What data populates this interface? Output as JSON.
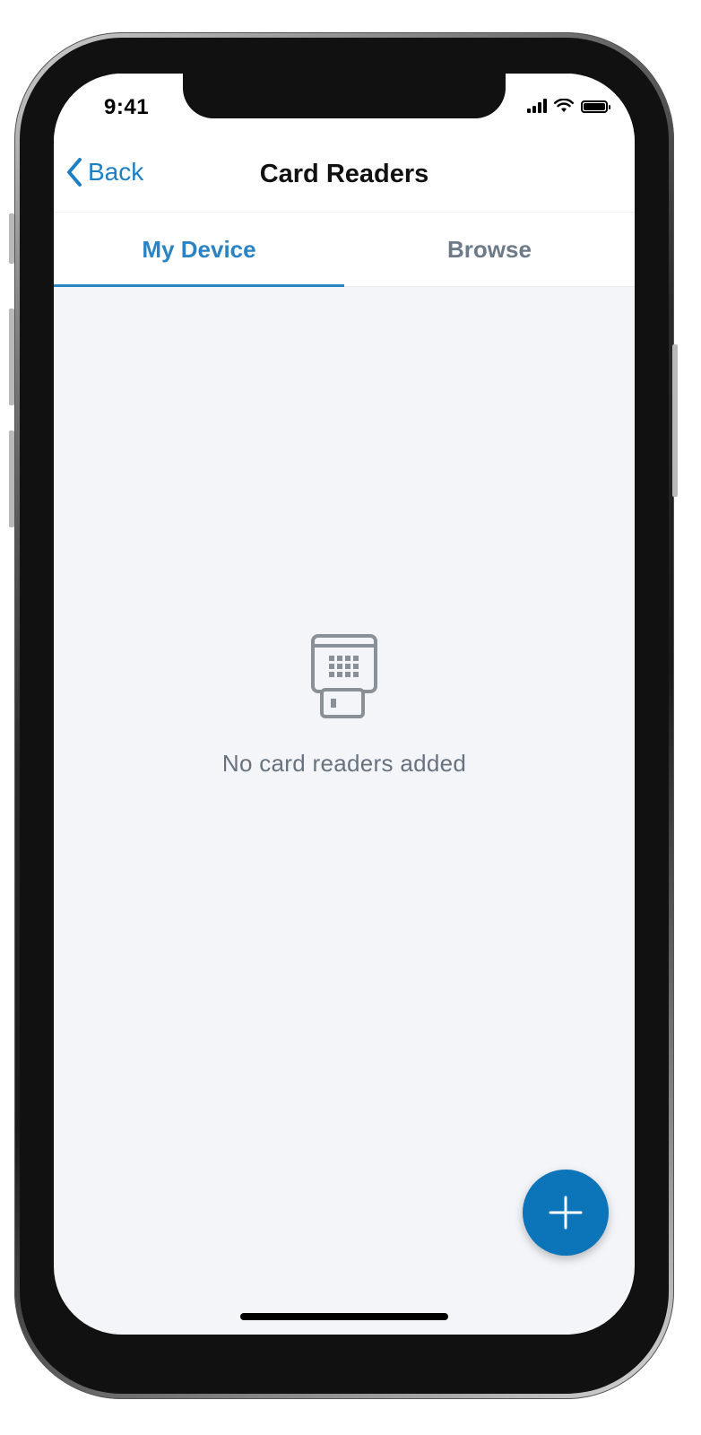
{
  "status_bar": {
    "time": "9:41",
    "icons": [
      "signal-icon",
      "wifi-icon",
      "battery-icon"
    ]
  },
  "nav": {
    "back_label": "Back",
    "title": "Card Readers"
  },
  "tabs": [
    {
      "label": "My Device",
      "active": true
    },
    {
      "label": "Browse",
      "active": false
    }
  ],
  "empty_state": {
    "icon": "card-reader-icon",
    "message": "No card readers added"
  },
  "fab": {
    "icon": "plus-icon"
  },
  "colors": {
    "accent": "#2a84c3",
    "fab": "#0c74b8",
    "background": "#f3f5f9",
    "muted_text": "#68727e"
  }
}
